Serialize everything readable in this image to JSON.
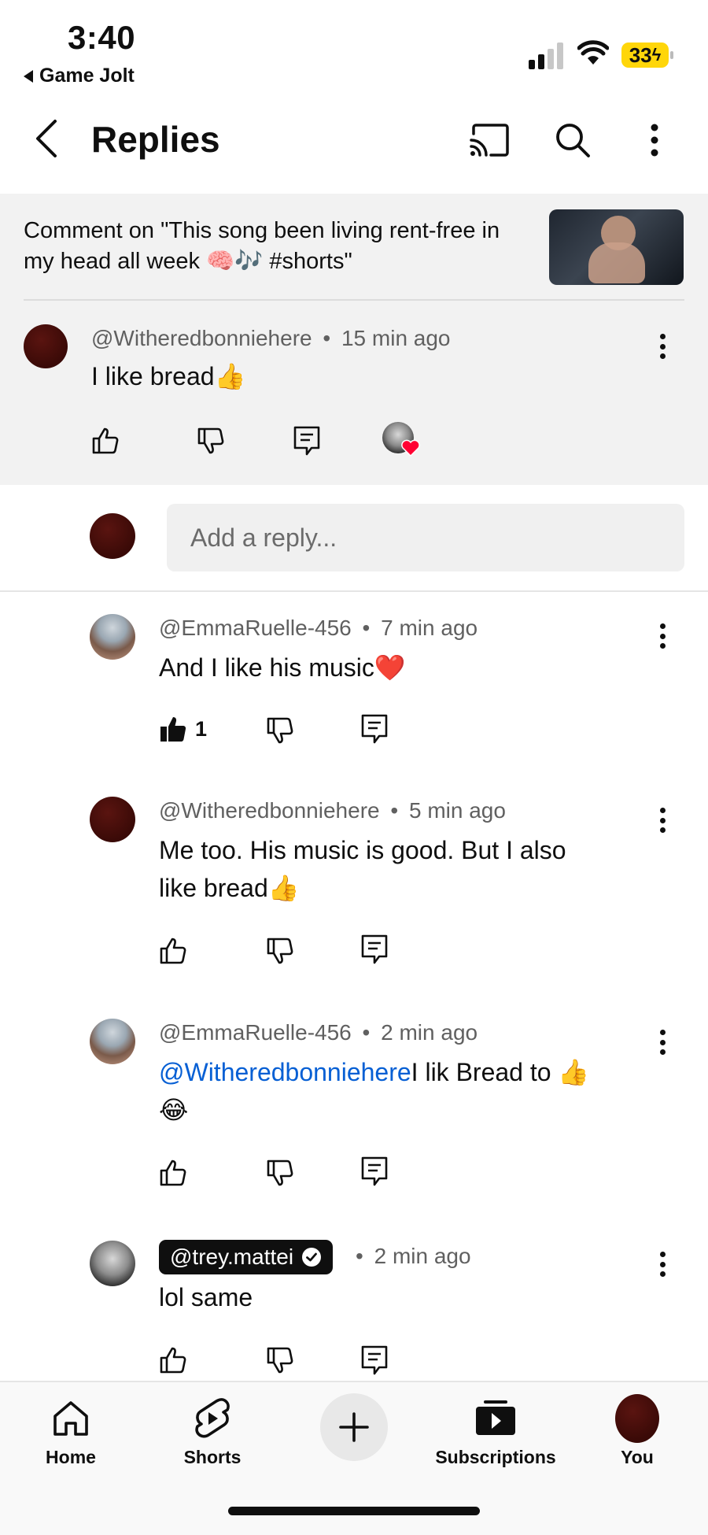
{
  "status_bar": {
    "time": "3:40",
    "back_app_label": "Game Jolt",
    "battery": "33"
  },
  "header": {
    "title": "Replies",
    "icons": [
      "back-icon",
      "cast-icon",
      "search-icon",
      "more-icon"
    ]
  },
  "context": {
    "text": "Comment on \"This song been living rent-free in my head all week 🧠🎶 #shorts\""
  },
  "parent_comment": {
    "author": "@Witheredbonniehere",
    "time": "15 min ago",
    "text": "I like bread👍"
  },
  "reply_input": {
    "placeholder": "Add a reply..."
  },
  "replies": [
    {
      "author": "@EmmaRuelle-456",
      "time": "7 min ago",
      "text": "And I like his music❤️",
      "likes": "1"
    },
    {
      "author": "@Witheredbonniehere",
      "time": "5 min ago",
      "text_line1": "Me too. His music is good. But I also",
      "text_line2": "like bread👍"
    },
    {
      "author": "@EmmaRuelle-456",
      "time": "2 min ago",
      "mention": "@Witheredbonniehere",
      "text_after_mention": "I lik Bread to 👍",
      "text_line2": "😂"
    },
    {
      "author": "@trey.mattei",
      "time": "2 min ago",
      "text": "lol same"
    }
  ],
  "meta_separator": "•",
  "bottom_nav": {
    "home": "Home",
    "shorts": "Shorts",
    "subscriptions": "Subscriptions",
    "you": "You"
  }
}
